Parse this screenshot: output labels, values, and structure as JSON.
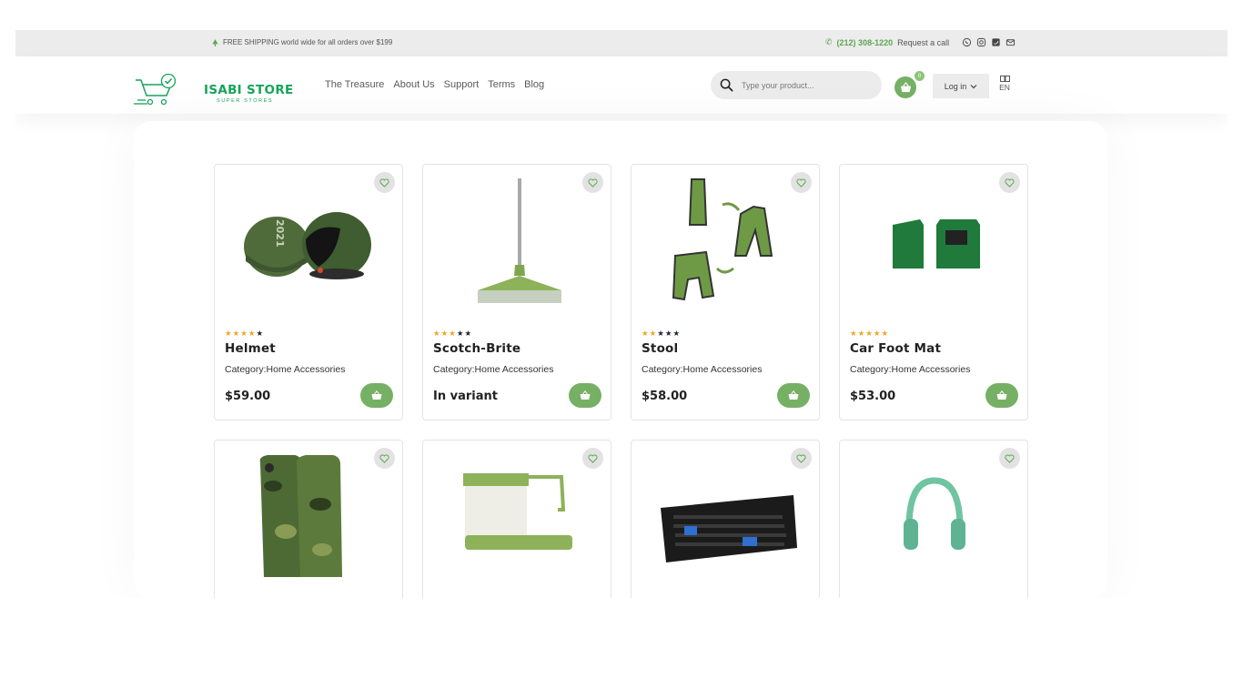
{
  "topbar": {
    "shipping_text": "FREE SHIPPING world wide for all orders over $199",
    "phone": "(212) 308-1220",
    "request_call": "Request a call",
    "social_icons": [
      "whatsapp-icon",
      "instagram-icon",
      "twitter-icon",
      "mail-icon"
    ]
  },
  "header": {
    "brand_name": "ISABI STORE",
    "brand_sub": "SUPER STORES",
    "nav": [
      "The Treasure",
      "About Us",
      "Support",
      "Terms",
      "Blog"
    ],
    "search_placeholder": "Type your product...",
    "cart_count": "0",
    "login_label": "Log in",
    "language": "EN"
  },
  "colors": {
    "accent": "#76b065",
    "brand": "#17a45a",
    "star_on": "#f0a52a",
    "star_off": "#1d2333"
  },
  "products": [
    {
      "name": "Helmet",
      "category": "Category:Home Accessories",
      "price": "$59.00",
      "rating": 4,
      "image": "helmet"
    },
    {
      "name": "Scotch-Brite",
      "category": "Category:Home Accessories",
      "price": "In variant",
      "rating": 3,
      "image": "squeegee"
    },
    {
      "name": "Stool",
      "category": "Category:Home Accessories",
      "price": "$58.00",
      "rating": 2,
      "image": "stool"
    },
    {
      "name": "Car Foot Mat",
      "category": "Category:Home Accessories",
      "price": "$53.00",
      "rating": 5,
      "image": "mat"
    },
    {
      "name": "",
      "category": "",
      "price": "",
      "rating": 0,
      "image": "keycover"
    },
    {
      "name": "",
      "category": "",
      "price": "",
      "rating": 0,
      "image": "sinkcaddy"
    },
    {
      "name": "",
      "category": "",
      "price": "",
      "rating": 0,
      "image": "keyboard"
    },
    {
      "name": "",
      "category": "",
      "price": "",
      "rating": 0,
      "image": "headphones"
    }
  ]
}
